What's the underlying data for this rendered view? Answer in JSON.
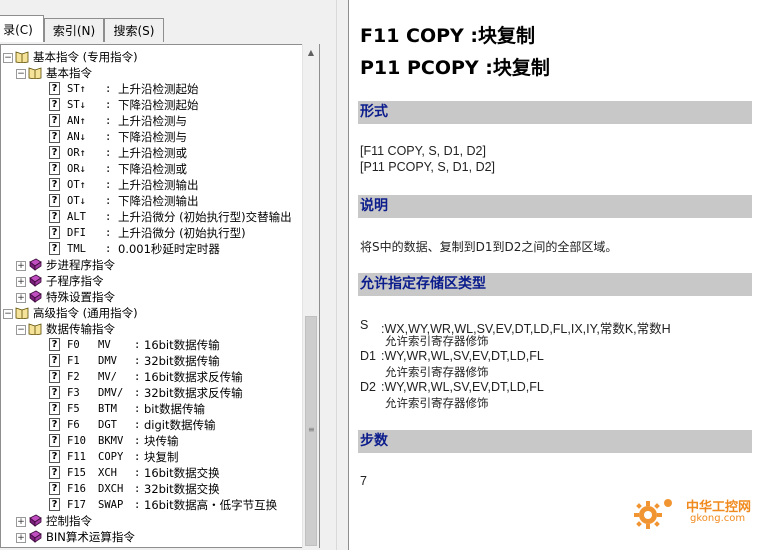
{
  "tabs": [
    {
      "label": "录(C)",
      "active": true
    },
    {
      "label": "索引(N)",
      "active": false
    },
    {
      "label": "搜索(S)",
      "active": false
    }
  ],
  "tree": {
    "basic_group": "基本指令 (专用指令)",
    "basic_sub": "基本指令",
    "basic_items": [
      {
        "code": "ST↑",
        "desc": "上升沿检测起始"
      },
      {
        "code": "ST↓",
        "desc": "下降沿检测起始"
      },
      {
        "code": "AN↑",
        "desc": "上升沿检测与"
      },
      {
        "code": "AN↓",
        "desc": "下降沿检测与"
      },
      {
        "code": "OR↑",
        "desc": "上升沿检测或"
      },
      {
        "code": "OR↓",
        "desc": "下降沿检测或"
      },
      {
        "code": "OT↑",
        "desc": "上升沿检测输出"
      },
      {
        "code": "OT↓",
        "desc": "下降沿检测输出"
      },
      {
        "code": "ALT",
        "desc": "上升沿微分 (初始执行型)交替输出"
      },
      {
        "code": "DFI",
        "desc": "上升沿微分 (初始执行型)"
      },
      {
        "code": "TML",
        "desc": "0.001秒延时定时器"
      }
    ],
    "basic_others": [
      "步进程序指令",
      "子程序指令",
      "特殊设置指令"
    ],
    "advanced_group": "高级指令 (通用指令)",
    "advanced_sub": "数据传输指令",
    "advanced_items": [
      {
        "code": "F0",
        "mnemonic": "MV",
        "desc": "16bit数据传输"
      },
      {
        "code": "F1",
        "mnemonic": "DMV",
        "desc": "32bit数据传输"
      },
      {
        "code": "F2",
        "mnemonic": "MV/",
        "desc": "16bit数据求反传输"
      },
      {
        "code": "F3",
        "mnemonic": "DMV/",
        "desc": "32bit数据求反传输"
      },
      {
        "code": "F5",
        "mnemonic": "BTM",
        "desc": "bit数据传输"
      },
      {
        "code": "F6",
        "mnemonic": "DGT",
        "desc": "digit数据传输"
      },
      {
        "code": "F10",
        "mnemonic": "BKMV",
        "desc": "块传输"
      },
      {
        "code": "F11",
        "mnemonic": "COPY",
        "desc": "块复制"
      },
      {
        "code": "F15",
        "mnemonic": "XCH",
        "desc": "16bit数据交换"
      },
      {
        "code": "F16",
        "mnemonic": "DXCH",
        "desc": "32bit数据交换"
      },
      {
        "code": "F17",
        "mnemonic": "SWAP",
        "desc": "16bit数据高・低字节互换"
      }
    ],
    "advanced_others": [
      "控制指令",
      "BIN算术运算指令"
    ],
    "colon": ":"
  },
  "content": {
    "title1": "F11 COPY :块复制",
    "title2": "P11 PCOPY :块复制",
    "section_format": "形式",
    "format_lines": [
      "[F11 COPY, S, D1, D2]",
      "[P11 PCOPY, S, D1, D2]"
    ],
    "section_desc": "说明",
    "desc_text": "将S中的数据、复制到D1到D2之间的全部区域。",
    "section_areas": "允许指定存储区类型",
    "areas": [
      {
        "label": "S",
        "value": ":WX,WY,WR,WL,SV,EV,DT,LD,FL,IX,IY,常数K,常数H",
        "note": "允许索引寄存器修饰"
      },
      {
        "label": "D1",
        "value": ":WY,WR,WL,SV,EV,DT,LD,FL",
        "note": "允许索引寄存器修饰"
      },
      {
        "label": "D2",
        "value": ":WY,WR,WL,SV,EV,DT,LD,FL",
        "note": "允许索引寄存器修饰"
      }
    ],
    "section_steps": "步数",
    "steps_value": "7"
  },
  "watermark": {
    "line1": "中华工控网",
    "line2": "gkong.com"
  },
  "colors": {
    "section_bar": "#c8c8c8",
    "section_text": "#0b1c8c",
    "watermark": "#f08a1e"
  }
}
